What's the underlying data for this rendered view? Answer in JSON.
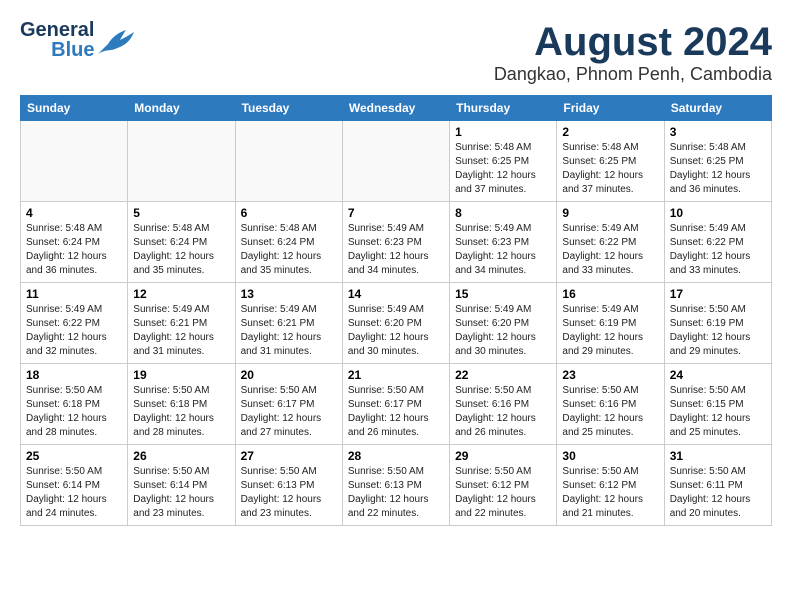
{
  "header": {
    "logo_general": "General",
    "logo_blue": "Blue",
    "month_title": "August 2024",
    "location": "Dangkao, Phnom Penh, Cambodia"
  },
  "weekdays": [
    "Sunday",
    "Monday",
    "Tuesday",
    "Wednesday",
    "Thursday",
    "Friday",
    "Saturday"
  ],
  "weeks": [
    [
      {
        "day": "",
        "info": ""
      },
      {
        "day": "",
        "info": ""
      },
      {
        "day": "",
        "info": ""
      },
      {
        "day": "",
        "info": ""
      },
      {
        "day": "1",
        "info": "Sunrise: 5:48 AM\nSunset: 6:25 PM\nDaylight: 12 hours\nand 37 minutes."
      },
      {
        "day": "2",
        "info": "Sunrise: 5:48 AM\nSunset: 6:25 PM\nDaylight: 12 hours\nand 37 minutes."
      },
      {
        "day": "3",
        "info": "Sunrise: 5:48 AM\nSunset: 6:25 PM\nDaylight: 12 hours\nand 36 minutes."
      }
    ],
    [
      {
        "day": "4",
        "info": "Sunrise: 5:48 AM\nSunset: 6:24 PM\nDaylight: 12 hours\nand 36 minutes."
      },
      {
        "day": "5",
        "info": "Sunrise: 5:48 AM\nSunset: 6:24 PM\nDaylight: 12 hours\nand 35 minutes."
      },
      {
        "day": "6",
        "info": "Sunrise: 5:48 AM\nSunset: 6:24 PM\nDaylight: 12 hours\nand 35 minutes."
      },
      {
        "day": "7",
        "info": "Sunrise: 5:49 AM\nSunset: 6:23 PM\nDaylight: 12 hours\nand 34 minutes."
      },
      {
        "day": "8",
        "info": "Sunrise: 5:49 AM\nSunset: 6:23 PM\nDaylight: 12 hours\nand 34 minutes."
      },
      {
        "day": "9",
        "info": "Sunrise: 5:49 AM\nSunset: 6:22 PM\nDaylight: 12 hours\nand 33 minutes."
      },
      {
        "day": "10",
        "info": "Sunrise: 5:49 AM\nSunset: 6:22 PM\nDaylight: 12 hours\nand 33 minutes."
      }
    ],
    [
      {
        "day": "11",
        "info": "Sunrise: 5:49 AM\nSunset: 6:22 PM\nDaylight: 12 hours\nand 32 minutes."
      },
      {
        "day": "12",
        "info": "Sunrise: 5:49 AM\nSunset: 6:21 PM\nDaylight: 12 hours\nand 31 minutes."
      },
      {
        "day": "13",
        "info": "Sunrise: 5:49 AM\nSunset: 6:21 PM\nDaylight: 12 hours\nand 31 minutes."
      },
      {
        "day": "14",
        "info": "Sunrise: 5:49 AM\nSunset: 6:20 PM\nDaylight: 12 hours\nand 30 minutes."
      },
      {
        "day": "15",
        "info": "Sunrise: 5:49 AM\nSunset: 6:20 PM\nDaylight: 12 hours\nand 30 minutes."
      },
      {
        "day": "16",
        "info": "Sunrise: 5:49 AM\nSunset: 6:19 PM\nDaylight: 12 hours\nand 29 minutes."
      },
      {
        "day": "17",
        "info": "Sunrise: 5:50 AM\nSunset: 6:19 PM\nDaylight: 12 hours\nand 29 minutes."
      }
    ],
    [
      {
        "day": "18",
        "info": "Sunrise: 5:50 AM\nSunset: 6:18 PM\nDaylight: 12 hours\nand 28 minutes."
      },
      {
        "day": "19",
        "info": "Sunrise: 5:50 AM\nSunset: 6:18 PM\nDaylight: 12 hours\nand 28 minutes."
      },
      {
        "day": "20",
        "info": "Sunrise: 5:50 AM\nSunset: 6:17 PM\nDaylight: 12 hours\nand 27 minutes."
      },
      {
        "day": "21",
        "info": "Sunrise: 5:50 AM\nSunset: 6:17 PM\nDaylight: 12 hours\nand 26 minutes."
      },
      {
        "day": "22",
        "info": "Sunrise: 5:50 AM\nSunset: 6:16 PM\nDaylight: 12 hours\nand 26 minutes."
      },
      {
        "day": "23",
        "info": "Sunrise: 5:50 AM\nSunset: 6:16 PM\nDaylight: 12 hours\nand 25 minutes."
      },
      {
        "day": "24",
        "info": "Sunrise: 5:50 AM\nSunset: 6:15 PM\nDaylight: 12 hours\nand 25 minutes."
      }
    ],
    [
      {
        "day": "25",
        "info": "Sunrise: 5:50 AM\nSunset: 6:14 PM\nDaylight: 12 hours\nand 24 minutes."
      },
      {
        "day": "26",
        "info": "Sunrise: 5:50 AM\nSunset: 6:14 PM\nDaylight: 12 hours\nand 23 minutes."
      },
      {
        "day": "27",
        "info": "Sunrise: 5:50 AM\nSunset: 6:13 PM\nDaylight: 12 hours\nand 23 minutes."
      },
      {
        "day": "28",
        "info": "Sunrise: 5:50 AM\nSunset: 6:13 PM\nDaylight: 12 hours\nand 22 minutes."
      },
      {
        "day": "29",
        "info": "Sunrise: 5:50 AM\nSunset: 6:12 PM\nDaylight: 12 hours\nand 22 minutes."
      },
      {
        "day": "30",
        "info": "Sunrise: 5:50 AM\nSunset: 6:12 PM\nDaylight: 12 hours\nand 21 minutes."
      },
      {
        "day": "31",
        "info": "Sunrise: 5:50 AM\nSunset: 6:11 PM\nDaylight: 12 hours\nand 20 minutes."
      }
    ]
  ]
}
